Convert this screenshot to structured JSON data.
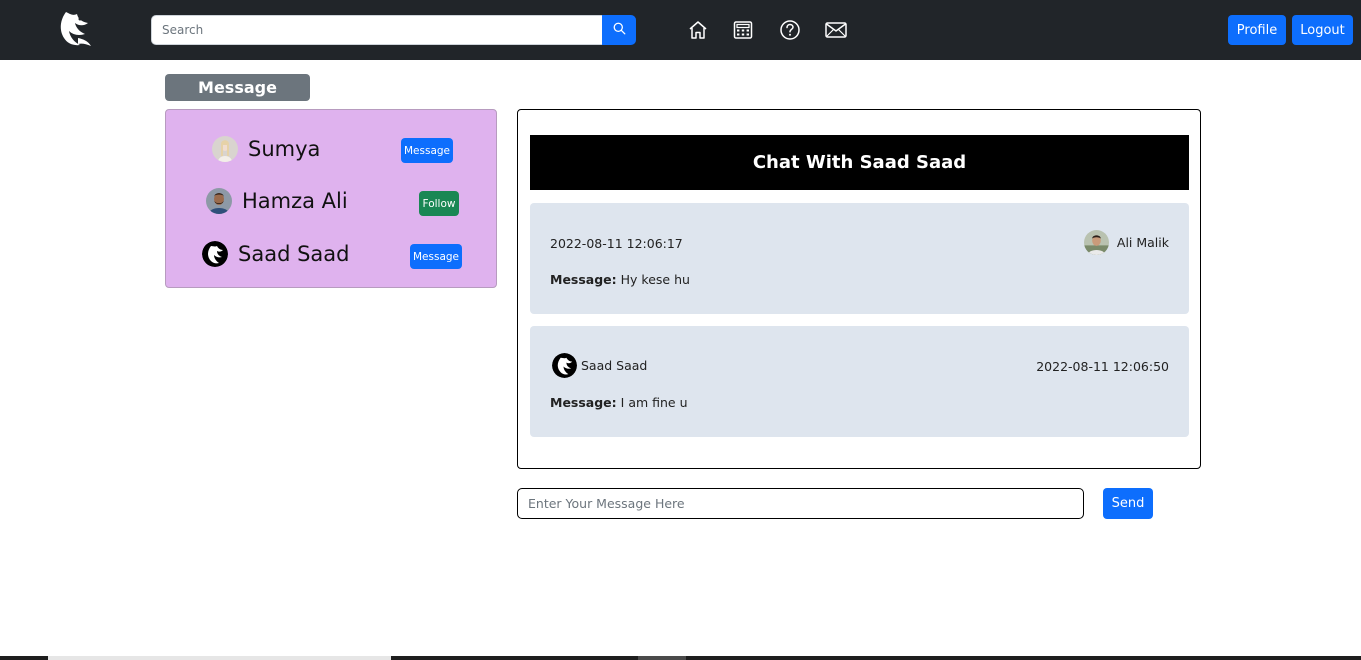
{
  "navbar": {
    "logo_icon": "eagle-logo-icon",
    "search": {
      "placeholder": "Search",
      "value": ""
    },
    "icons": [
      "home-icon",
      "calculator-icon",
      "help-circle-icon",
      "mail-icon"
    ],
    "profile_label": "Profile",
    "logout_label": "Logout"
  },
  "sidebar": {
    "title": "Message",
    "users": [
      {
        "name": "Sumya",
        "action": "Message",
        "action_color": "#0d6efd"
      },
      {
        "name": "Hamza Ali",
        "action": "Follow",
        "action_color": "#198754"
      },
      {
        "name": "Saad Saad",
        "action": "Message",
        "action_color": "#0d6efd"
      }
    ]
  },
  "chat": {
    "title": "Chat With Saad Saad",
    "messages": [
      {
        "timestamp": "2022-08-11 12:06:17",
        "sender": "Ali Malik",
        "label": "Message:",
        "text": "Hy kese hu"
      },
      {
        "timestamp": "2022-08-11 12:06:50",
        "sender": "Saad Saad",
        "label": "Message:",
        "text": "I am fine u"
      }
    ]
  },
  "compose": {
    "placeholder": "Enter Your Message Here",
    "value": "",
    "send_label": "Send"
  },
  "colors": {
    "navbar_bg": "#212529",
    "primary": "#0d6efd",
    "success": "#198754",
    "panel_bg": "#dfb2ee",
    "card_bg": "#dee5ee",
    "title_bg": "#6c757d"
  }
}
